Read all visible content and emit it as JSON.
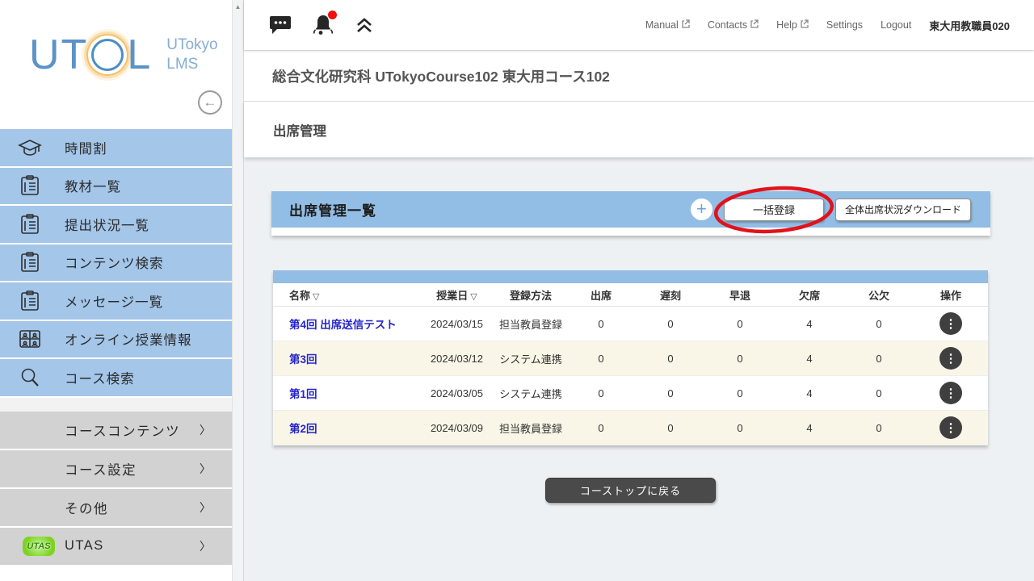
{
  "sidebar": {
    "logo": {
      "brand_left": "UT",
      "brand_right": "L",
      "sub_line1": "UTokyo",
      "sub_line2": "LMS"
    },
    "nav_items": [
      {
        "label": "時間割",
        "icon": "graduation-cap-icon"
      },
      {
        "label": "教材一覧",
        "icon": "clipboard-icon"
      },
      {
        "label": "提出状況一覧",
        "icon": "clipboard-icon"
      },
      {
        "label": "コンテンツ検索",
        "icon": "clipboard-icon"
      },
      {
        "label": "メッセージ一覧",
        "icon": "clipboard-icon"
      },
      {
        "label": "オンライン授業情報",
        "icon": "online-class-icon"
      },
      {
        "label": "コース検索",
        "icon": "search-icon"
      }
    ],
    "group_items": [
      {
        "label": "コースコンテンツ"
      },
      {
        "label": "コース設定"
      },
      {
        "label": "その他"
      },
      {
        "label": "UTAS",
        "badge": "UTAS"
      }
    ]
  },
  "topbar": {
    "links": [
      {
        "label": "Manual",
        "external": true
      },
      {
        "label": "Contacts",
        "external": true
      },
      {
        "label": "Help",
        "external": true
      },
      {
        "label": "Settings",
        "external": false
      },
      {
        "label": "Logout",
        "external": false
      }
    ],
    "username": "東大用教職員020"
  },
  "header": {
    "course_title": "総合文化研究科 UTokyoCourse102 東大用コース102",
    "page_title": "出席管理"
  },
  "panel": {
    "title": "出席管理一覧",
    "bulk_register_label": "一括登録",
    "download_label": "全体出席状況ダウンロード"
  },
  "table": {
    "columns": [
      {
        "label": "名称",
        "sort": "▽"
      },
      {
        "label": "授業日",
        "sort": "▽"
      },
      {
        "label": "登録方法"
      },
      {
        "label": "出席"
      },
      {
        "label": "遅刻"
      },
      {
        "label": "早退"
      },
      {
        "label": "欠席"
      },
      {
        "label": "公欠"
      },
      {
        "label": "操作"
      }
    ],
    "rows": [
      {
        "name": "第4回 出席送信テスト",
        "date": "2024/03/15",
        "method": "担当教員登録",
        "present": "0",
        "late": "0",
        "early": "0",
        "absent": "4",
        "excused": "0"
      },
      {
        "name": "第3回",
        "date": "2024/03/12",
        "method": "システム連携",
        "present": "0",
        "late": "0",
        "early": "0",
        "absent": "4",
        "excused": "0"
      },
      {
        "name": "第1回",
        "date": "2024/03/05",
        "method": "システム連携",
        "present": "0",
        "late": "0",
        "early": "0",
        "absent": "4",
        "excused": "0"
      },
      {
        "name": "第2回",
        "date": "2024/03/09",
        "method": "担当教員登録",
        "present": "0",
        "late": "0",
        "early": "0",
        "absent": "4",
        "excused": "0"
      }
    ]
  },
  "footer": {
    "back_button_label": "コーストップに戻る"
  },
  "icons": {
    "add": "+",
    "operations": "⋮",
    "chevron_right": "〉",
    "scroll_up": "▲",
    "back_arrow": "←"
  },
  "colors": {
    "sidebar_item_blue": "#a3c6e9",
    "panel_blue": "#92bde4",
    "row_cream": "#faf6e7",
    "annotation_red": "#e0131c",
    "link_blue": "#2525cc",
    "notification_red": "#ef1010"
  }
}
